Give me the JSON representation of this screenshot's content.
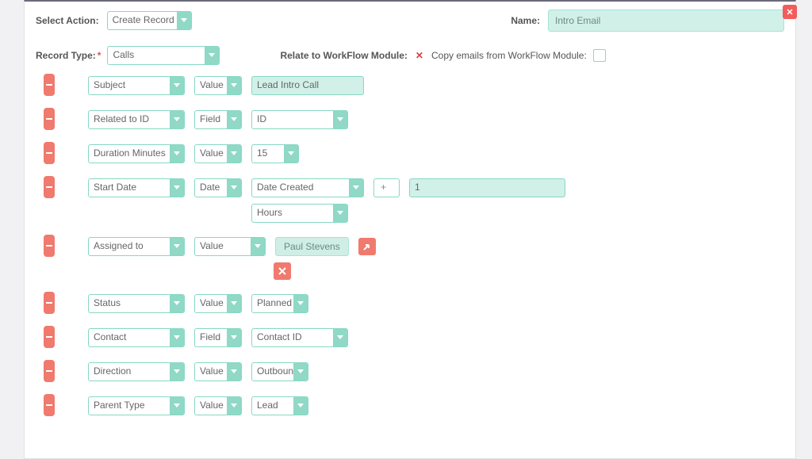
{
  "header": {
    "select_action_label": "Select Action:",
    "select_action_value": "Create Record",
    "name_label": "Name:",
    "name_value": "Intro Email"
  },
  "subheader": {
    "record_type_label": "Record Type:",
    "record_type_value": "Calls",
    "relate_label": "Relate to WorkFlow Module:",
    "copy_label": "Copy emails from WorkFlow Module:"
  },
  "rows": {
    "subject": {
      "field": "Subject",
      "type": "Value",
      "value": "Lead Intro Call"
    },
    "related": {
      "field": "Related to ID",
      "type": "Field",
      "value": "ID"
    },
    "duration": {
      "field": "Duration Minutes",
      "type": "Value",
      "value": "15"
    },
    "start": {
      "field": "Start Date",
      "type": "Date",
      "base": "Date Created",
      "op": "+",
      "offset": "1",
      "unit": "Hours"
    },
    "assigned": {
      "field": "Assigned to",
      "type": "Value",
      "tag": "Paul Stevens"
    },
    "status": {
      "field": "Status",
      "type": "Value",
      "value": "Planned"
    },
    "contact": {
      "field": "Contact",
      "type": "Field",
      "value": "Contact ID"
    },
    "direction": {
      "field": "Direction",
      "type": "Value",
      "value": "Outbound"
    },
    "parent": {
      "field": "Parent Type",
      "type": "Value",
      "value": "Lead"
    }
  }
}
